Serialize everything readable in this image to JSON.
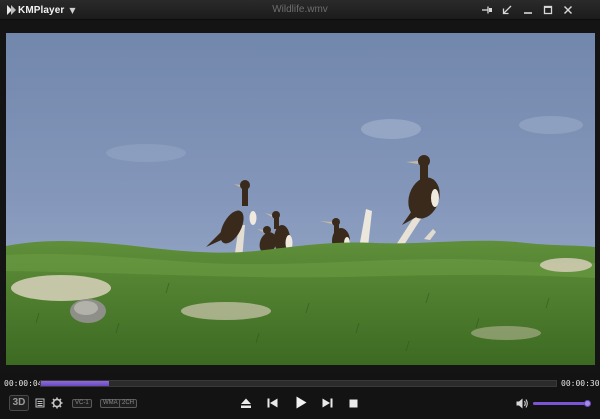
{
  "app": {
    "name": "KMPlayer",
    "file_title": "Wildlife.wmv"
  },
  "icons": {
    "menu": "chevron-down-icon",
    "window_controls": [
      "pin-icon",
      "compact-mode-icon",
      "minimize-icon",
      "maximize-icon",
      "close-icon"
    ],
    "left_controls": [
      "3d-icon",
      "playlist-icon",
      "settings-icon"
    ],
    "transport": [
      "eject-icon",
      "previous-icon",
      "play-icon",
      "next-icon",
      "stop-icon"
    ],
    "volume": "speaker-icon"
  },
  "playback": {
    "current_time": "00:00:04",
    "total_time": "00:00:30",
    "progress": 0.133
  },
  "left_controls": {
    "mode_3d_label": "3D"
  },
  "codec_tags": [
    "VC-1",
    "WMA",
    "2CH"
  ],
  "volume": {
    "level": 0.97
  },
  "colors": {
    "accent": "#7a55d6",
    "seek_fill": "#7a5ad0",
    "background": "#141414",
    "title_text": "#6d6d6d"
  }
}
